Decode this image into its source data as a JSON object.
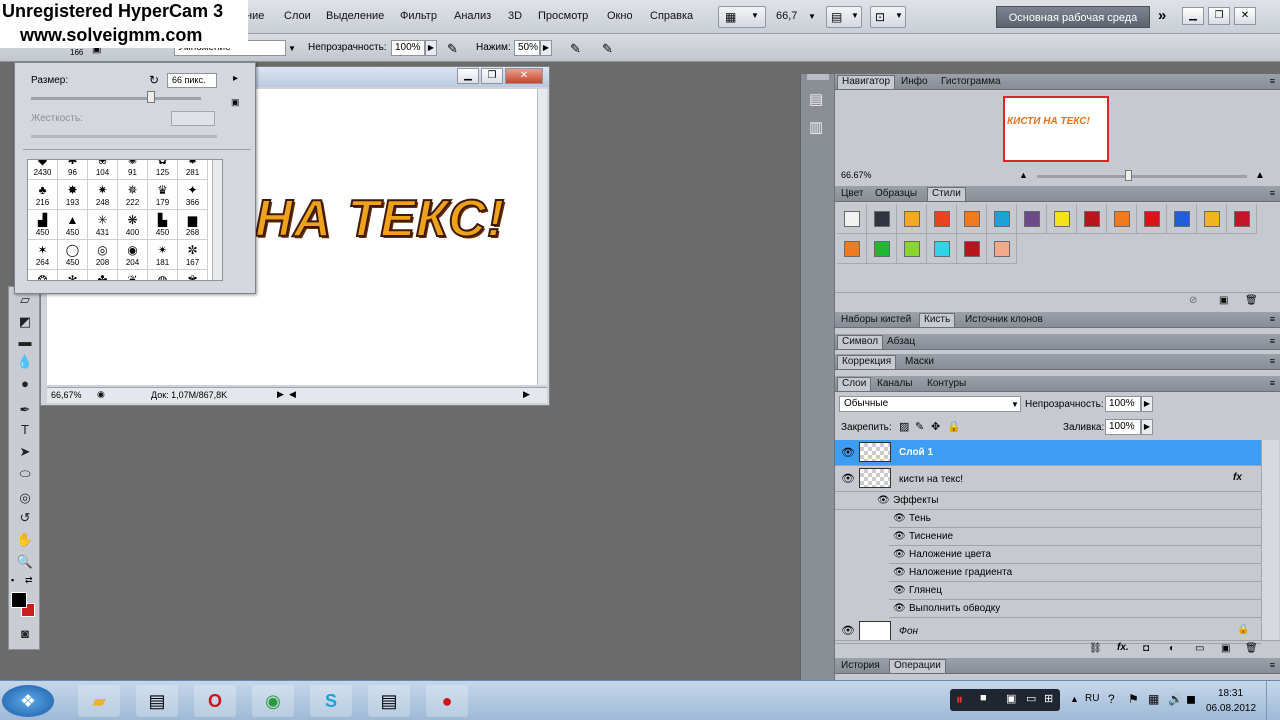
{
  "watermark": {
    "line1": "Unregistered HyperCam 3",
    "line2": "www.solveigmm.com"
  },
  "menubar": {
    "items": [
      "ние",
      "Слои",
      "Выделение",
      "Фильтр",
      "Анализ",
      "3D",
      "Просмотр",
      "Окно",
      "Справка"
    ],
    "zoom": "66,7",
    "workspace": "Основная рабочая среда",
    "more": "»"
  },
  "optionsbar": {
    "brush_size": "166",
    "mode_value": "Умножение",
    "opacity_label": "Непрозрачность:",
    "opacity_value": "100%",
    "flow_label": "Нажим:",
    "flow_value": "50%"
  },
  "brush_picker": {
    "size_label": "Размер:",
    "size_value": "66 пикс.",
    "hardness_label": "Жесткость:",
    "rows": [
      [
        "2430",
        "96",
        "104",
        "91",
        "125",
        "281"
      ],
      [
        "216",
        "193",
        "248",
        "222",
        "179",
        "366"
      ],
      [
        "450",
        "450",
        "431",
        "400",
        "450",
        "268"
      ],
      [
        "264",
        "450",
        "208",
        "204",
        "181",
        "167"
      ]
    ]
  },
  "document": {
    "canvas_text": "НА ТЕКС!",
    "zoom": "66,67%",
    "doc_info": "Док: 1,07M/867,8K"
  },
  "navigator": {
    "tabs": [
      "Навигатор",
      "Инфо",
      "Гистограмма"
    ],
    "zoom": "66.67%",
    "thumb_text": "КИСТИ НА ТЕКС!"
  },
  "styles": {
    "tabs": [
      "Цвет",
      "Образцы",
      "Стили"
    ],
    "colors": [
      "#f2f2f2",
      "#2f3440",
      "#f5a623",
      "#e8451f",
      "#f07a1e",
      "#1aa3d6",
      "#6d4a8a",
      "#f3e21a",
      "#b8151c",
      "#f07a1e",
      "#d9141b",
      "#1e5fd6",
      "#f0b41e",
      "#c4142a",
      "#f07a1e",
      "#1fb832",
      "#8ad62e",
      "#32d2e8",
      "#b8151c",
      "#f2a88a"
    ]
  },
  "brush_panels": {
    "tabs": [
      "Наборы кистей",
      "Кисть",
      "Источник клонов"
    ]
  },
  "char_panels": {
    "tabs": [
      "Символ",
      "Абзац"
    ]
  },
  "corr_panels": {
    "tabs": [
      "Коррекция",
      "Маски"
    ]
  },
  "layers": {
    "tabs": [
      "Слои",
      "Каналы",
      "Контуры"
    ],
    "blend_mode": "Обычные",
    "opacity_label": "Непрозрачность:",
    "opacity_value": "100%",
    "lock_label": "Закрепить:",
    "fill_label": "Заливка:",
    "fill_value": "100%",
    "layer1": "Слой 1",
    "text_layer": "кисти на текс!",
    "effects_label": "Эффекты",
    "effects": [
      "Тень",
      "Тиснение",
      "Наложение цвета",
      "Наложение градиента",
      "Глянец",
      "Выполнить обводку"
    ],
    "background": "Фон",
    "fx": "fx"
  },
  "bottom_panels": {
    "tabs": [
      "История",
      "Операции"
    ]
  },
  "taskbar": {
    "lang": "RU",
    "time": "18:31",
    "date": "06.08.2012"
  }
}
